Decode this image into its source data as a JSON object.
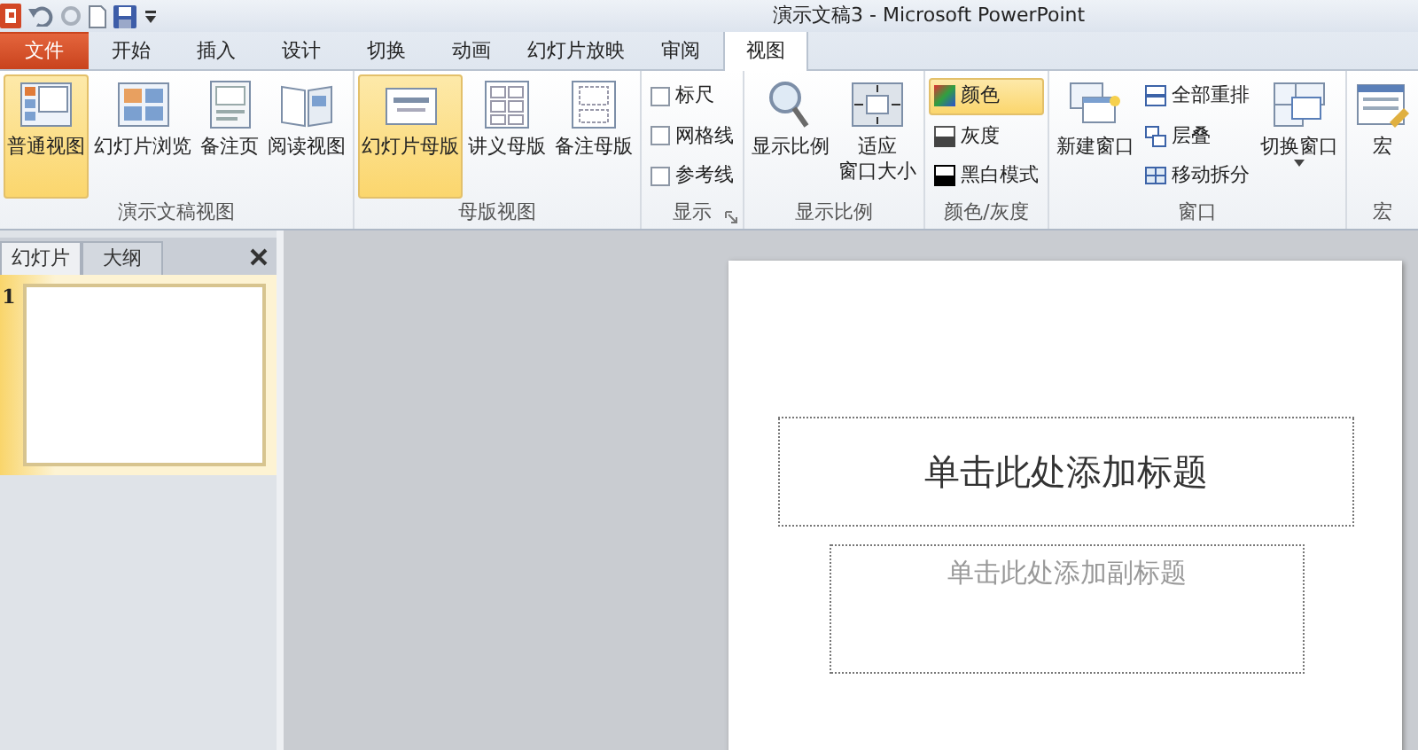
{
  "title_bar": {
    "title": "演示文稿3  -  Microsoft PowerPoint"
  },
  "tabs": [
    {
      "label": "文件",
      "kind": "file",
      "selected": false
    },
    {
      "label": "开始",
      "kind": "normal",
      "selected": false
    },
    {
      "label": "插入",
      "kind": "normal",
      "selected": false
    },
    {
      "label": "设计",
      "kind": "normal",
      "selected": false
    },
    {
      "label": "切换",
      "kind": "normal",
      "selected": false
    },
    {
      "label": "动画",
      "kind": "normal",
      "selected": false
    },
    {
      "label": "幻灯片放映",
      "kind": "normal",
      "selected": false
    },
    {
      "label": "审阅",
      "kind": "normal",
      "selected": false
    },
    {
      "label": "视图",
      "kind": "normal",
      "selected": true
    }
  ],
  "ribbon_groups": [
    {
      "label": "演示文稿视图",
      "columns": [
        {
          "kind": "large",
          "label": "普通视图",
          "selected": true
        },
        {
          "kind": "large",
          "label": "幻灯片浏览",
          "selected": false
        },
        {
          "kind": "large",
          "label": "备注页",
          "selected": false
        },
        {
          "kind": "large",
          "label": "阅读视图",
          "selected": false
        }
      ]
    },
    {
      "label": "母版视图",
      "columns": [
        {
          "kind": "large",
          "label": "幻灯片母版",
          "selected": true
        },
        {
          "kind": "large",
          "label": "讲义母版",
          "selected": false
        },
        {
          "kind": "large",
          "label": "备注母版",
          "selected": false
        }
      ]
    },
    {
      "label": "显示",
      "launcher": true,
      "columns": [
        {
          "kind": "stack",
          "items": [
            {
              "kind": "check",
              "label": "标尺",
              "checked": false
            },
            {
              "kind": "check",
              "label": "网格线",
              "checked": false
            },
            {
              "kind": "check",
              "label": "参考线",
              "checked": false
            }
          ]
        }
      ]
    },
    {
      "label": "显示比例",
      "columns": [
        {
          "kind": "large",
          "label": "显示比例",
          "selected": false
        },
        {
          "kind": "large",
          "lines": [
            "适应",
            "窗口大小"
          ],
          "selected": false
        }
      ]
    },
    {
      "label": "颜色/灰度",
      "columns": [
        {
          "kind": "stack",
          "items": [
            {
              "kind": "small",
              "label": "颜色",
              "selected": true
            },
            {
              "kind": "small",
              "label": "灰度",
              "selected": false
            },
            {
              "kind": "small",
              "label": "黑白模式",
              "selected": false
            }
          ]
        }
      ]
    },
    {
      "label": "窗口",
      "columns": [
        {
          "kind": "large",
          "label": "新建窗口",
          "selected": false
        },
        {
          "kind": "stack",
          "items": [
            {
              "kind": "small",
              "label": "全部重排",
              "selected": false
            },
            {
              "kind": "small",
              "label": "层叠",
              "selected": false
            },
            {
              "kind": "small",
              "label": "移动拆分",
              "selected": false
            }
          ]
        },
        {
          "kind": "large",
          "label": "切换窗口",
          "selected": false,
          "dropdown": true
        }
      ]
    },
    {
      "label": "宏",
      "columns": [
        {
          "kind": "large",
          "label": "宏",
          "selected": false
        }
      ]
    }
  ],
  "side_panel": {
    "tabs": [
      {
        "label": "幻灯片",
        "selected": true
      },
      {
        "label": "大纲",
        "selected": false
      }
    ],
    "slides": [
      {
        "number": "1",
        "selected": true
      }
    ]
  },
  "slide": {
    "title_placeholder": "单击此处添加标题",
    "subtitle_placeholder": "单击此处添加副标题"
  }
}
